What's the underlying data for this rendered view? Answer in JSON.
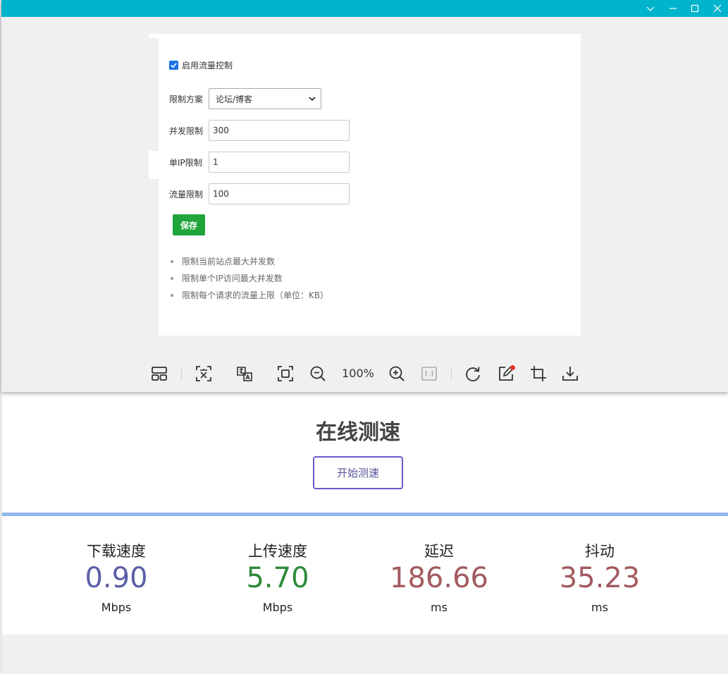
{
  "viewer": {
    "settings": {
      "enable_flow_control": {
        "label": "启用流量控制",
        "checked": true
      },
      "fields": [
        {
          "label": "限制方案",
          "type": "select",
          "value": "论坛/博客"
        },
        {
          "label": "并发限制",
          "type": "input",
          "value": "300"
        },
        {
          "label": "单IP限制",
          "type": "input",
          "value": "1"
        },
        {
          "label": "流量限制",
          "type": "input",
          "value": "100"
        }
      ],
      "save_label": "保存",
      "notes": [
        "限制当前站点最大并发数",
        "限制单个IP访问最大并发数",
        "限制每个请求的流量上限（单位：KB）"
      ]
    },
    "toolbar": {
      "zoom": "100%",
      "icons": [
        "layout-icon",
        "ocr-text-icon",
        "translate-icon",
        "fit-screen-icon",
        "zoom-out-icon",
        "zoom-in-icon",
        "actual-size-icon",
        "rotate-icon",
        "edit-icon",
        "crop-icon",
        "download-icon"
      ]
    },
    "accent_color": "#00b4cc"
  },
  "speedtest": {
    "title": "在线测速",
    "start_label": "开始测速",
    "metrics": [
      {
        "label": "下载速度",
        "value": "0.90",
        "unit": "Mbps",
        "color": "#5b5fa5"
      },
      {
        "label": "上传速度",
        "value": "5.70",
        "unit": "Mbps",
        "color": "#2e8b3a"
      },
      {
        "label": "延迟",
        "value": "186.66",
        "unit": "ms",
        "color": "#a35a5f"
      },
      {
        "label": "抖动",
        "value": "35.23",
        "unit": "ms",
        "color": "#a35a5f"
      }
    ]
  }
}
